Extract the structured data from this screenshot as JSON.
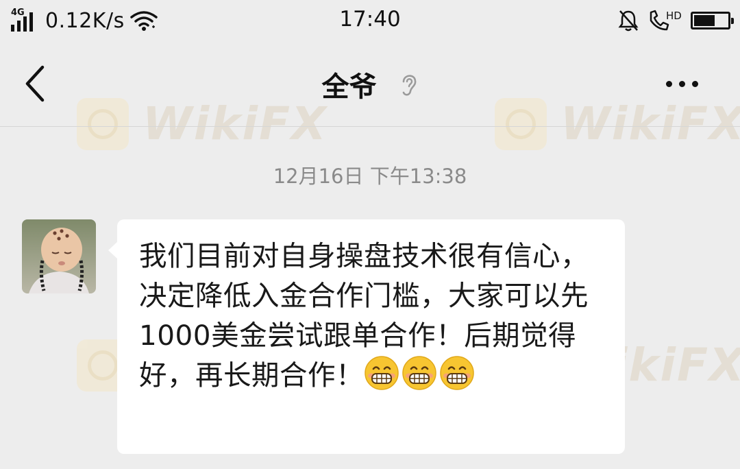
{
  "status_bar": {
    "network": "4G",
    "speed": "0.12K/s",
    "time": "17:40",
    "hd_label": "HD",
    "battery_level": 0.62
  },
  "nav": {
    "back_icon": "chevron-left-icon",
    "title": "全爷",
    "ear_icon": "ear-icon",
    "more_icon": "more-dots-icon"
  },
  "chat": {
    "timestamp": "12月16日 下午13:38",
    "messages": [
      {
        "sender": "全爷",
        "text": "我们目前对自身操盘技术很有信心，决定降低入金合作门槛，大家可以先1000美金尝试跟单合作！后期觉得好，再长期合作！",
        "emojis": [
          "grin-emoji",
          "grin-emoji",
          "grin-emoji"
        ]
      }
    ]
  },
  "watermark": {
    "text": "WikiFX"
  },
  "colors": {
    "background": "#ededed",
    "bubble": "#ffffff",
    "timestamp": "#8a8a8a",
    "text": "#191919"
  }
}
